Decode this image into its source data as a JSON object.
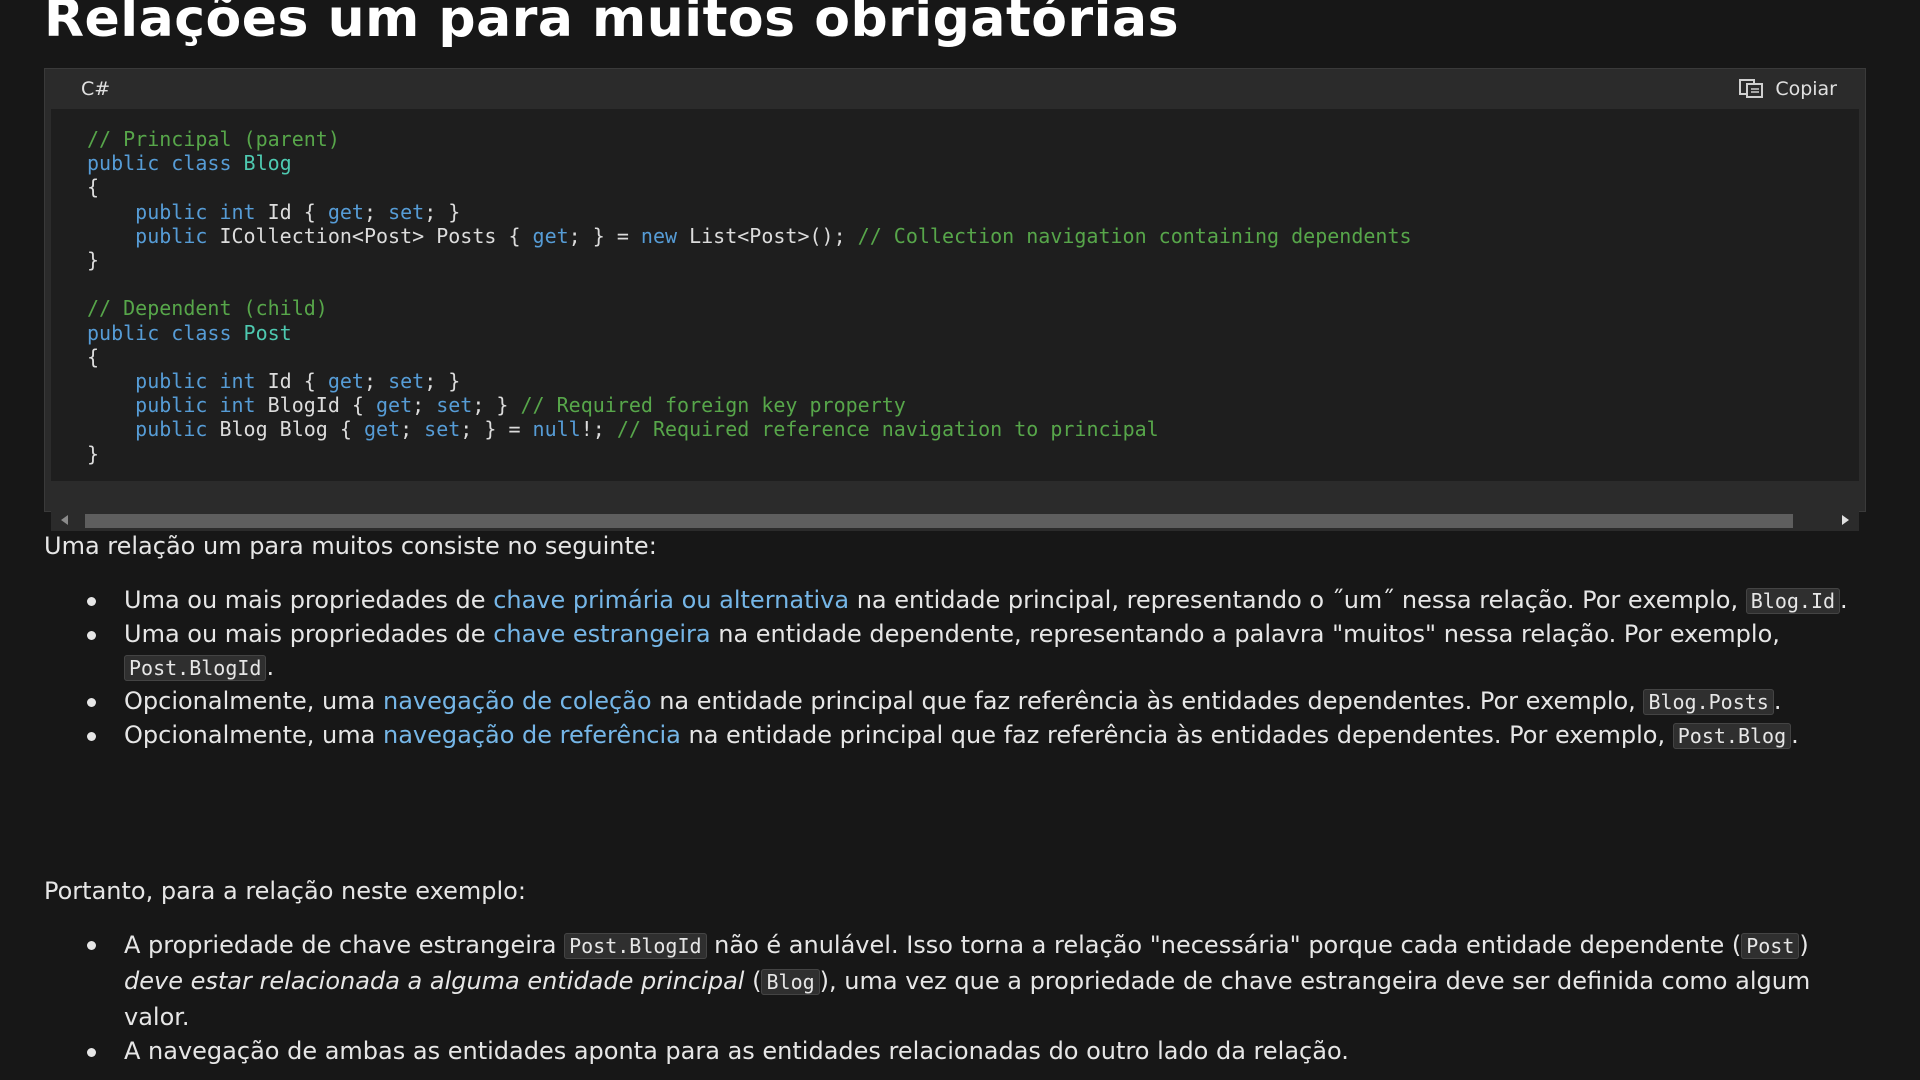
{
  "page": {
    "title": "Relações um para muitos obrigatórias"
  },
  "code_block": {
    "language": "C#",
    "copy_label": "Copiar",
    "lines": [
      [
        {
          "t": "// Principal (parent)",
          "k": "comment"
        }
      ],
      [
        {
          "t": "public class ",
          "k": "keyword"
        },
        {
          "t": "Blog",
          "k": "type"
        }
      ],
      [
        {
          "t": "{",
          "k": "plain"
        }
      ],
      [
        {
          "t": "    public int ",
          "k": "keyword"
        },
        {
          "t": "Id { ",
          "k": "plain"
        },
        {
          "t": "get",
          "k": "keyword"
        },
        {
          "t": "; ",
          "k": "plain"
        },
        {
          "t": "set",
          "k": "keyword"
        },
        {
          "t": "; }",
          "k": "plain"
        }
      ],
      [
        {
          "t": "    public ",
          "k": "keyword"
        },
        {
          "t": "ICollection<Post> Posts { ",
          "k": "plain"
        },
        {
          "t": "get",
          "k": "keyword"
        },
        {
          "t": "; } = ",
          "k": "plain"
        },
        {
          "t": "new ",
          "k": "keyword"
        },
        {
          "t": "List<Post>(); ",
          "k": "plain"
        },
        {
          "t": "// Collection navigation containing dependents",
          "k": "comment"
        }
      ],
      [
        {
          "t": "}",
          "k": "plain"
        }
      ],
      [
        {
          "t": "",
          "k": "plain"
        }
      ],
      [
        {
          "t": "// Dependent (child)",
          "k": "comment"
        }
      ],
      [
        {
          "t": "public class ",
          "k": "keyword"
        },
        {
          "t": "Post",
          "k": "type"
        }
      ],
      [
        {
          "t": "{",
          "k": "plain"
        }
      ],
      [
        {
          "t": "    public int ",
          "k": "keyword"
        },
        {
          "t": "Id { ",
          "k": "plain"
        },
        {
          "t": "get",
          "k": "keyword"
        },
        {
          "t": "; ",
          "k": "plain"
        },
        {
          "t": "set",
          "k": "keyword"
        },
        {
          "t": "; }",
          "k": "plain"
        }
      ],
      [
        {
          "t": "    public int ",
          "k": "keyword"
        },
        {
          "t": "BlogId { ",
          "k": "plain"
        },
        {
          "t": "get",
          "k": "keyword"
        },
        {
          "t": "; ",
          "k": "plain"
        },
        {
          "t": "set",
          "k": "keyword"
        },
        {
          "t": "; } ",
          "k": "plain"
        },
        {
          "t": "// Required foreign key property",
          "k": "comment"
        }
      ],
      [
        {
          "t": "    public ",
          "k": "keyword"
        },
        {
          "t": "Blog Blog { ",
          "k": "plain"
        },
        {
          "t": "get",
          "k": "keyword"
        },
        {
          "t": "; ",
          "k": "plain"
        },
        {
          "t": "set",
          "k": "keyword"
        },
        {
          "t": "; } = ",
          "k": "plain"
        },
        {
          "t": "null",
          "k": "keyword"
        },
        {
          "t": "!; ",
          "k": "plain"
        },
        {
          "t": "// Required reference navigation to principal",
          "k": "comment"
        }
      ],
      [
        {
          "t": "}",
          "k": "plain"
        }
      ]
    ]
  },
  "intro": {
    "text": "Uma relação um para muitos consiste no seguinte:"
  },
  "list1": [
    {
      "pre": "Uma ou mais propriedades de ",
      "link": "chave primária ou alternativa",
      "post": " na entidade principal, representando o ˝um˝ nessa relação. Por exemplo, ",
      "code": "Blog.Id",
      "end": "."
    },
    {
      "pre": "Uma ou mais propriedades de ",
      "link": "chave estrangeira",
      "post": " na entidade dependente, representando a palavra \"muitos\" nessa relação. Por exemplo, ",
      "code": "Post.BlogId",
      "end": "."
    },
    {
      "pre": "Opcionalmente, uma ",
      "link": "navegação de coleção",
      "post": " na entidade principal que faz referência às entidades dependentes. Por exemplo, ",
      "code": "Blog.Posts",
      "end": "."
    },
    {
      "pre": "Opcionalmente, uma ",
      "link": "navegação de referência",
      "post": " na entidade principal que faz referência às entidades dependentes. Por exemplo, ",
      "code": "Post.Blog",
      "end": "."
    }
  ],
  "therefore": {
    "text": "Portanto, para a relação neste exemplo:"
  },
  "list2": {
    "item1": {
      "a": "A propriedade de chave estrangeira ",
      "code1": "Post.BlogId",
      "b": " não é anulável. Isso torna a relação \"necessária\" porque cada entidade dependente (",
      "code2": "Post",
      "c": ") ",
      "em": "deve estar relacionada a alguma entidade principal",
      "d": " (",
      "code3": "Blog",
      "e": "), uma vez que a propriedade de chave estrangeira deve ser definida como algum valor."
    },
    "item2": {
      "text": "A navegação de ambas as entidades aponta para as entidades relacionadas do outro lado da relação."
    }
  },
  "colors": {
    "background": "#171717",
    "link": "#75b6e7",
    "comment": "#57a64a",
    "keyword": "#569cd6",
    "type": "#4ec9b0"
  }
}
